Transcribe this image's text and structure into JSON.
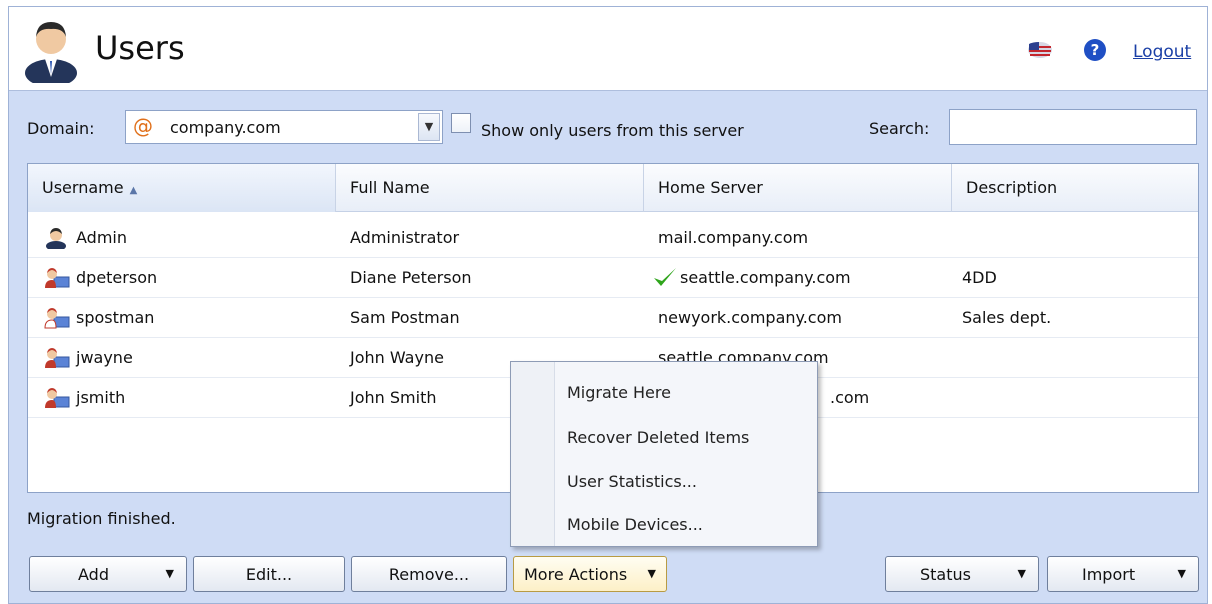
{
  "header": {
    "title": "Users",
    "logout_label": "Logout"
  },
  "toolbar": {
    "domain_label": "Domain:",
    "domain_value": "company.com",
    "server_only_label": "Show only users from this server",
    "server_only_checked": false,
    "search_label": "Search:",
    "search_value": ""
  },
  "grid": {
    "columns": [
      "Username",
      "Full Name",
      "Home Server",
      "Description"
    ],
    "sorted_column": "Username",
    "rows": [
      {
        "icon": "admin-user-icon",
        "username": "Admin",
        "full_name": "Administrator",
        "home_server": "mail.company.com",
        "description": "",
        "migrated": false
      },
      {
        "icon": "user-icon",
        "username": "dpeterson",
        "full_name": "Diane Peterson",
        "home_server": "seattle.company.com",
        "description": "4DD",
        "migrated": true
      },
      {
        "icon": "user-icon",
        "username": "spostman",
        "full_name": "Sam Postman",
        "home_server": "newyork.company.com",
        "description": "Sales dept.",
        "migrated": false
      },
      {
        "icon": "user-icon",
        "username": "jwayne",
        "full_name": "John Wayne",
        "home_server": "seattle.company.com",
        "description": "",
        "migrated": false
      },
      {
        "icon": "user-icon",
        "username": "jsmith",
        "full_name": "John Smith",
        "home_server": ".com",
        "description": "",
        "migrated": false
      }
    ]
  },
  "status_message": "Migration finished.",
  "buttons": {
    "add": "Add",
    "edit": "Edit...",
    "remove": "Remove...",
    "more_actions": "More Actions",
    "status": "Status",
    "import": "Import"
  },
  "context_menu": {
    "items": [
      "Migrate Here",
      "Recover Deleted Items",
      "User Statistics...",
      "Mobile Devices..."
    ]
  },
  "colors": {
    "background": "#cfdcf5",
    "link": "#1a3fa6",
    "check": "#2fa51c"
  }
}
